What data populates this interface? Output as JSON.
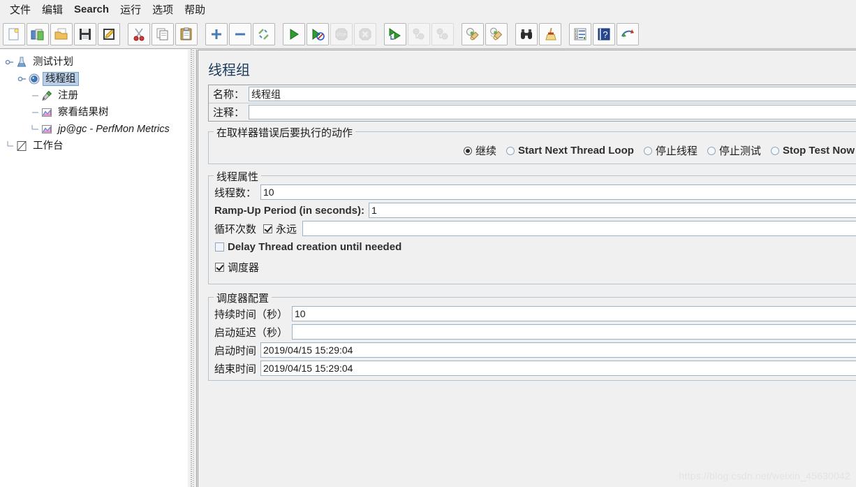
{
  "menubar": {
    "items": [
      {
        "label": "文件",
        "latin": false
      },
      {
        "label": "编辑",
        "latin": false
      },
      {
        "label": "Search",
        "latin": true
      },
      {
        "label": "运行",
        "latin": false
      },
      {
        "label": "选项",
        "latin": false
      },
      {
        "label": "帮助",
        "latin": false
      }
    ]
  },
  "toolbar": {
    "groups": [
      {
        "buttons": [
          {
            "icon": "new-file-icon",
            "enabled": true
          },
          {
            "icon": "templates-icon",
            "enabled": true
          },
          {
            "icon": "open-folder-icon",
            "enabled": true
          },
          {
            "icon": "save-icon",
            "enabled": true
          },
          {
            "icon": "save-as-icon",
            "enabled": true
          }
        ]
      },
      {
        "buttons": [
          {
            "icon": "cut-icon",
            "enabled": true
          },
          {
            "icon": "copy-icon",
            "enabled": true
          },
          {
            "icon": "paste-icon",
            "enabled": true
          }
        ]
      },
      {
        "buttons": [
          {
            "icon": "expand-all-icon",
            "enabled": true
          },
          {
            "icon": "collapse-all-icon",
            "enabled": true
          },
          {
            "icon": "toggle-icon",
            "enabled": true
          }
        ]
      },
      {
        "buttons": [
          {
            "icon": "start-icon",
            "enabled": true
          },
          {
            "icon": "start-no-pauses-icon",
            "enabled": true
          },
          {
            "icon": "stop-icon",
            "enabled": false
          },
          {
            "icon": "shutdown-icon",
            "enabled": false
          }
        ]
      },
      {
        "buttons": [
          {
            "icon": "remote-start-all-icon",
            "enabled": true
          },
          {
            "icon": "remote-stop-all-icon",
            "enabled": false
          },
          {
            "icon": "remote-shutdown-all-icon",
            "enabled": false
          }
        ]
      },
      {
        "buttons": [
          {
            "icon": "clear-icon",
            "enabled": true
          },
          {
            "icon": "clear-all-icon",
            "enabled": true
          }
        ]
      },
      {
        "buttons": [
          {
            "icon": "search-binoculars-icon",
            "enabled": true
          },
          {
            "icon": "reset-search-broom-icon",
            "enabled": true
          }
        ]
      },
      {
        "buttons": [
          {
            "icon": "function-helper-icon",
            "enabled": true
          },
          {
            "icon": "help-book-icon",
            "enabled": true
          },
          {
            "icon": "undo-redo-icon",
            "enabled": true
          }
        ]
      }
    ]
  },
  "tree": {
    "nodes": [
      {
        "label": "测试计划",
        "icon": "test-plan-icon",
        "depth": 0,
        "selected": false,
        "italic": false,
        "expanded": true
      },
      {
        "label": "线程组",
        "icon": "thread-group-icon",
        "depth": 1,
        "selected": true,
        "italic": false,
        "expanded": true
      },
      {
        "label": "注册",
        "icon": "http-sampler-icon",
        "depth": 2,
        "selected": false,
        "italic": false,
        "expanded": false
      },
      {
        "label": "察看结果树",
        "icon": "view-results-tree-icon",
        "depth": 2,
        "selected": false,
        "italic": false,
        "expanded": false
      },
      {
        "label": "jp@gc - PerfMon Metrics",
        "icon": "perfmon-listener-icon",
        "depth": 2,
        "selected": false,
        "italic": true,
        "expanded": false
      },
      {
        "label": "工作台",
        "icon": "workbench-icon",
        "depth": 0,
        "selected": false,
        "italic": false,
        "expanded": false
      }
    ]
  },
  "main": {
    "title": "线程组",
    "name_label": "名称：",
    "name_value": "线程组",
    "comment_label": "注释：",
    "comment_value": "",
    "error_action": {
      "title": "在取样器错误后要执行的动作",
      "options": [
        {
          "label": "继续",
          "selected": true,
          "latin": false
        },
        {
          "label": "Start Next Thread Loop",
          "selected": false,
          "latin": true
        },
        {
          "label": "停止线程",
          "selected": false,
          "latin": false
        },
        {
          "label": "停止测试",
          "selected": false,
          "latin": false
        },
        {
          "label": "Stop Test Now",
          "selected": false,
          "latin": true
        }
      ]
    },
    "thread_properties": {
      "title": "线程属性",
      "threads_label": "线程数：",
      "threads_value": "10",
      "rampup_label": "Ramp-Up Period (in seconds):",
      "rampup_value": "1",
      "loop_label": "循环次数",
      "forever_label": "永远",
      "forever_checked": true,
      "loop_value": "",
      "delay_label": "Delay Thread creation until needed",
      "delay_checked": false,
      "scheduler_label": "调度器",
      "scheduler_checked": true
    },
    "scheduler_config": {
      "title": "调度器配置",
      "duration_label": "持续时间（秒）",
      "duration_value": "10",
      "startup_delay_label": "启动延迟（秒）",
      "startup_delay_value": "",
      "start_time_label": "启动时间",
      "start_time_value": "2019/04/15 15:29:04",
      "end_time_label": "结束时间",
      "end_time_value": "2019/04/15 15:29:04"
    }
  },
  "watermark": {
    "text": "https://blog.csdn.net/weixin_45630042"
  },
  "colors": {
    "accent": "#1b3a5c",
    "selection": "#b9cfe7",
    "field_border": "#9bb3c9",
    "panel_bg": "#f0f0f0"
  }
}
